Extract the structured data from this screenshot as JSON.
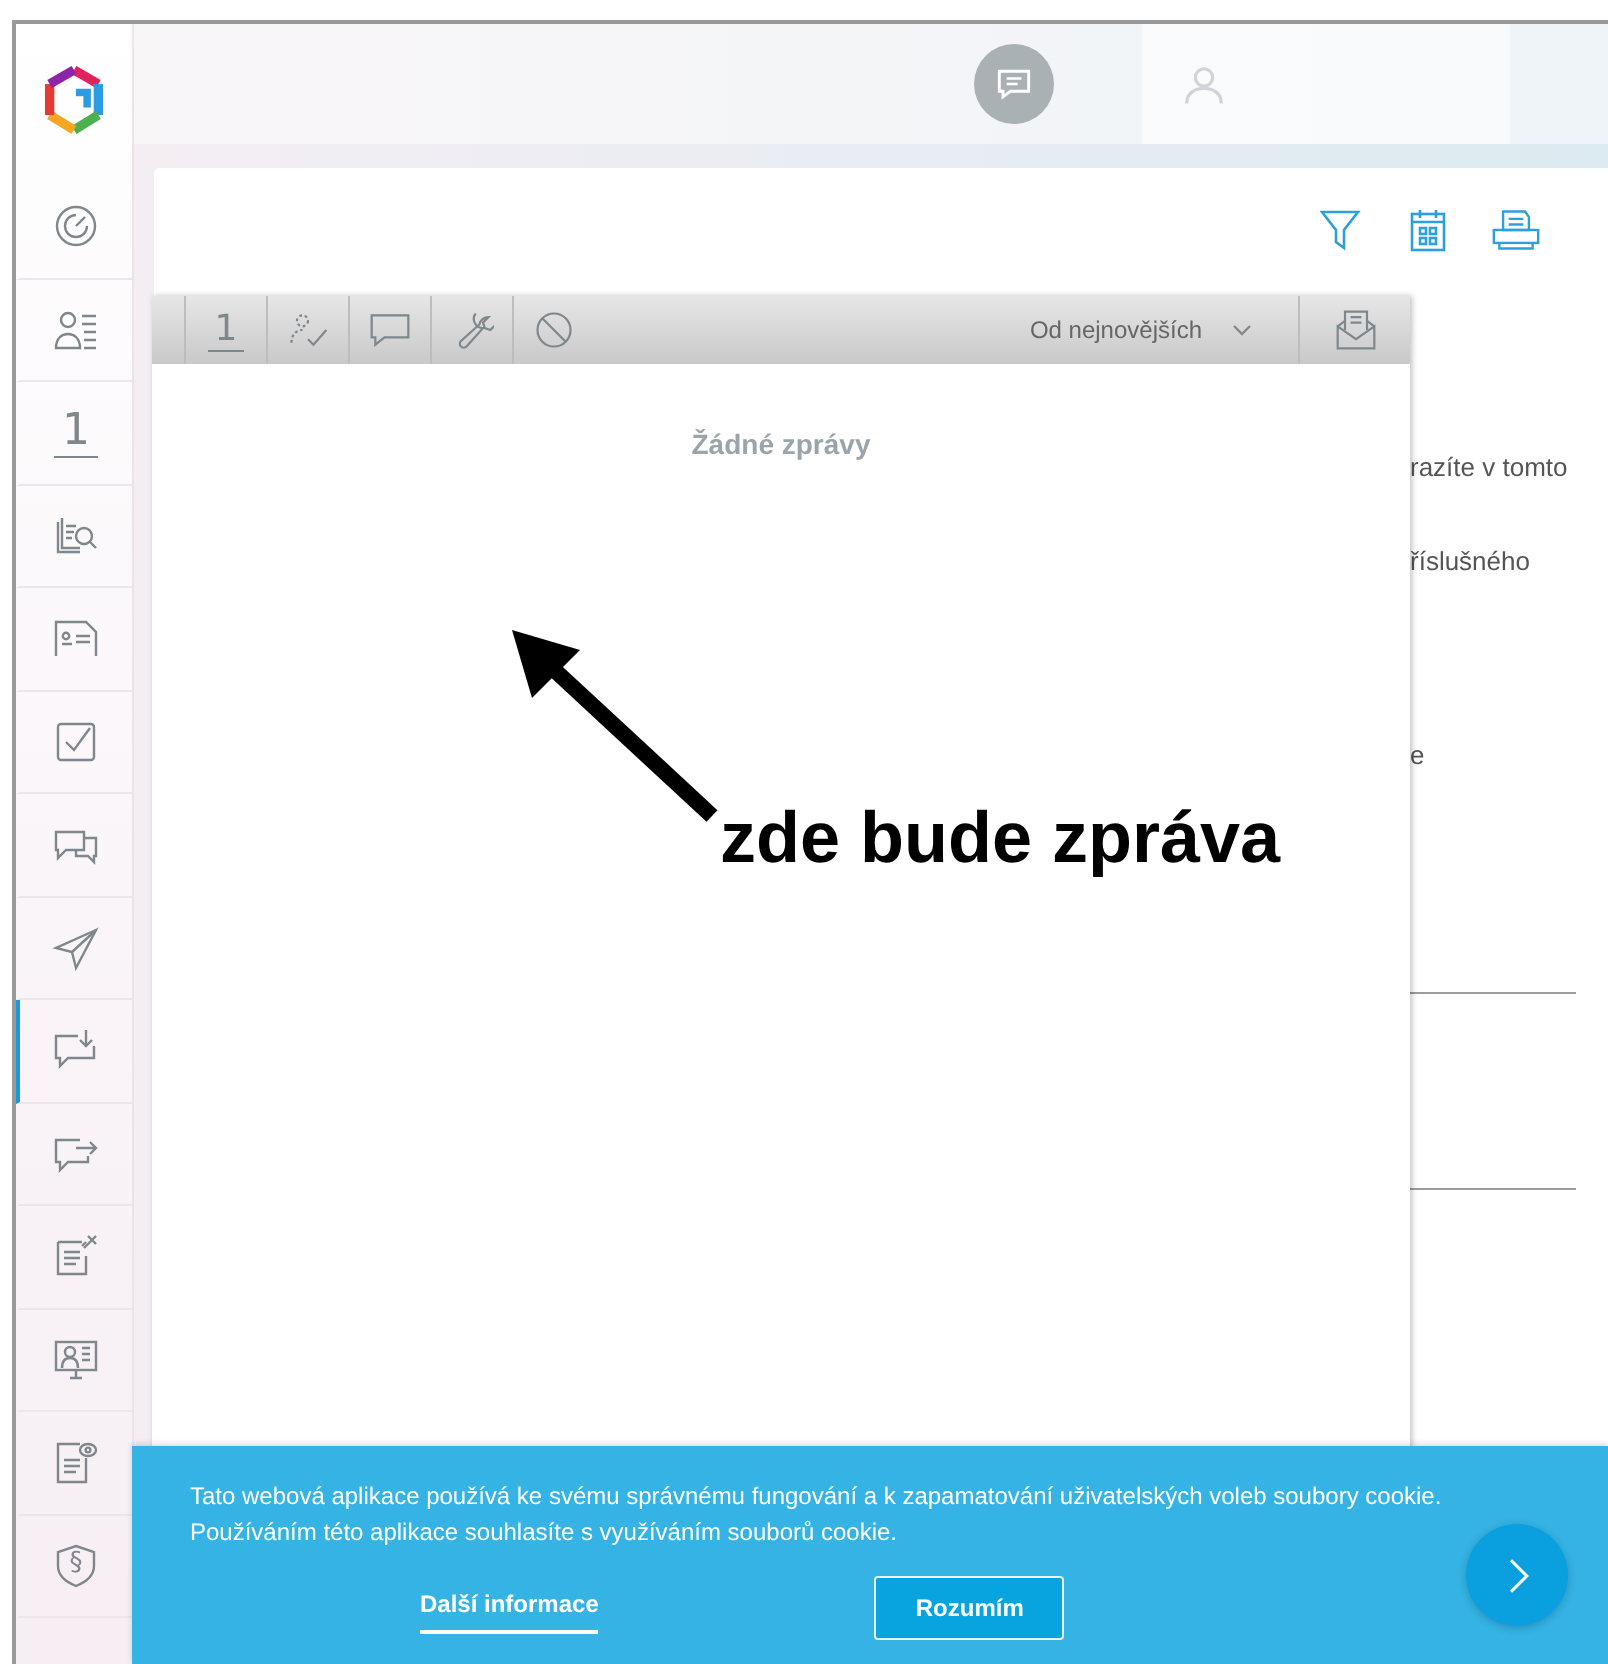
{
  "sidebar": {
    "items": [
      {
        "kind": "gauge",
        "selected": false
      },
      {
        "kind": "person-list",
        "selected": false
      },
      {
        "kind": "number",
        "label": "1",
        "selected": false
      },
      {
        "kind": "book-search",
        "selected": false
      },
      {
        "kind": "id-card",
        "selected": false
      },
      {
        "kind": "checkbox",
        "selected": false
      },
      {
        "kind": "chat-pair",
        "selected": false
      },
      {
        "kind": "send",
        "selected": false
      },
      {
        "kind": "inbox",
        "selected": true
      },
      {
        "kind": "outbox",
        "selected": false
      },
      {
        "kind": "note-pin",
        "selected": false
      },
      {
        "kind": "monitor-person",
        "selected": false
      },
      {
        "kind": "doc-eye",
        "selected": false
      },
      {
        "kind": "shield",
        "label": "§",
        "selected": false
      }
    ]
  },
  "messages_panel": {
    "toolbar": [
      {
        "kind": "number",
        "label": "1"
      },
      {
        "kind": "person-check"
      },
      {
        "kind": "comment"
      },
      {
        "kind": "wrench"
      },
      {
        "kind": "block"
      }
    ],
    "sort": "Od nejnovějších",
    "empty_text": "Žádné zprávy"
  },
  "background_text": [
    "razíte v tomto",
    "říslušného",
    "e"
  ],
  "annotation": "zde bude zpráva",
  "cookie_bar": {
    "lines": [
      "Tato webová aplikace používá ke svému správnému fungování a k zapamatování uživatelských voleb soubory cookie.",
      "Používáním této aplikace souhlasíte s využíváním souborů cookie."
    ],
    "more_link": "Další informace",
    "accept_button": "Rozumím"
  }
}
